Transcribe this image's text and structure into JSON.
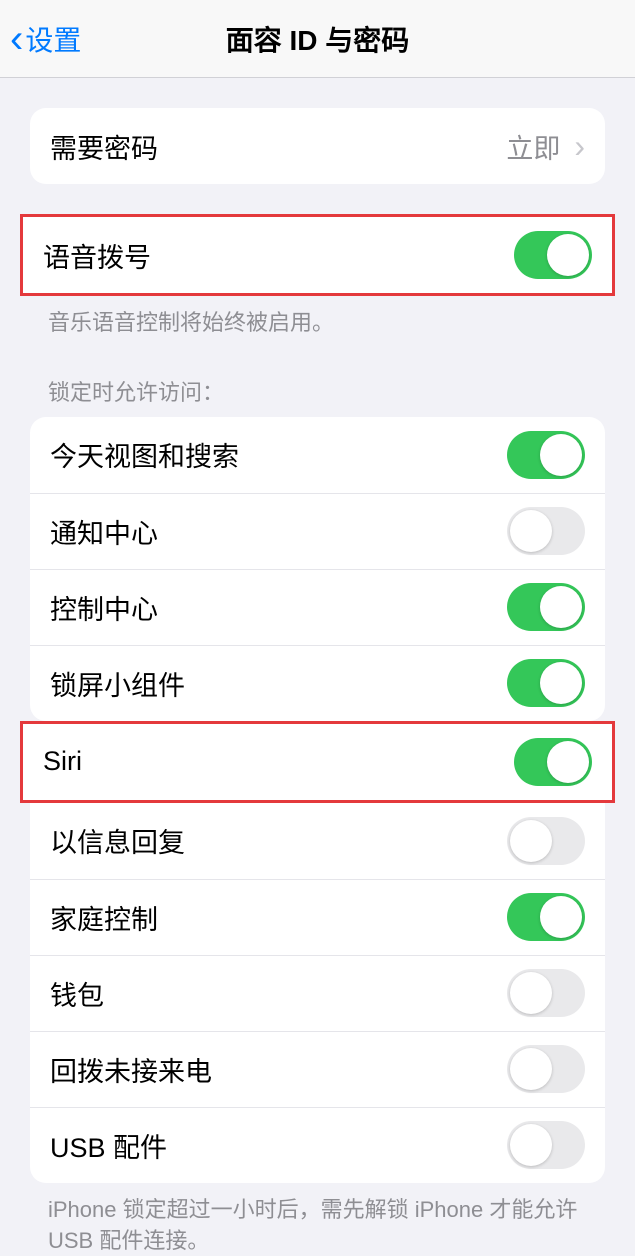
{
  "nav": {
    "back": "设置",
    "title": "面容 ID 与密码"
  },
  "requirePasscode": {
    "label": "需要密码",
    "value": "立即"
  },
  "voiceDial": {
    "label": "语音拨号",
    "on": true,
    "note": "音乐语音控制将始终被启用。"
  },
  "lockAccessHeader": "锁定时允许访问：",
  "lockAccess": {
    "today": {
      "label": "今天视图和搜索",
      "on": true
    },
    "notif": {
      "label": "通知中心",
      "on": false
    },
    "control": {
      "label": "控制中心",
      "on": true
    },
    "widgets": {
      "label": "锁屏小组件",
      "on": true
    },
    "siri": {
      "label": "Siri",
      "on": true
    },
    "reply": {
      "label": "以信息回复",
      "on": false
    },
    "home": {
      "label": "家庭控制",
      "on": true
    },
    "wallet": {
      "label": "钱包",
      "on": false
    },
    "callback": {
      "label": "回拨未接来电",
      "on": false
    },
    "usb": {
      "label": "USB 配件",
      "on": false
    }
  },
  "usbNote": "iPhone 锁定超过一小时后，需先解锁 iPhone 才能允许 USB 配件连接。"
}
